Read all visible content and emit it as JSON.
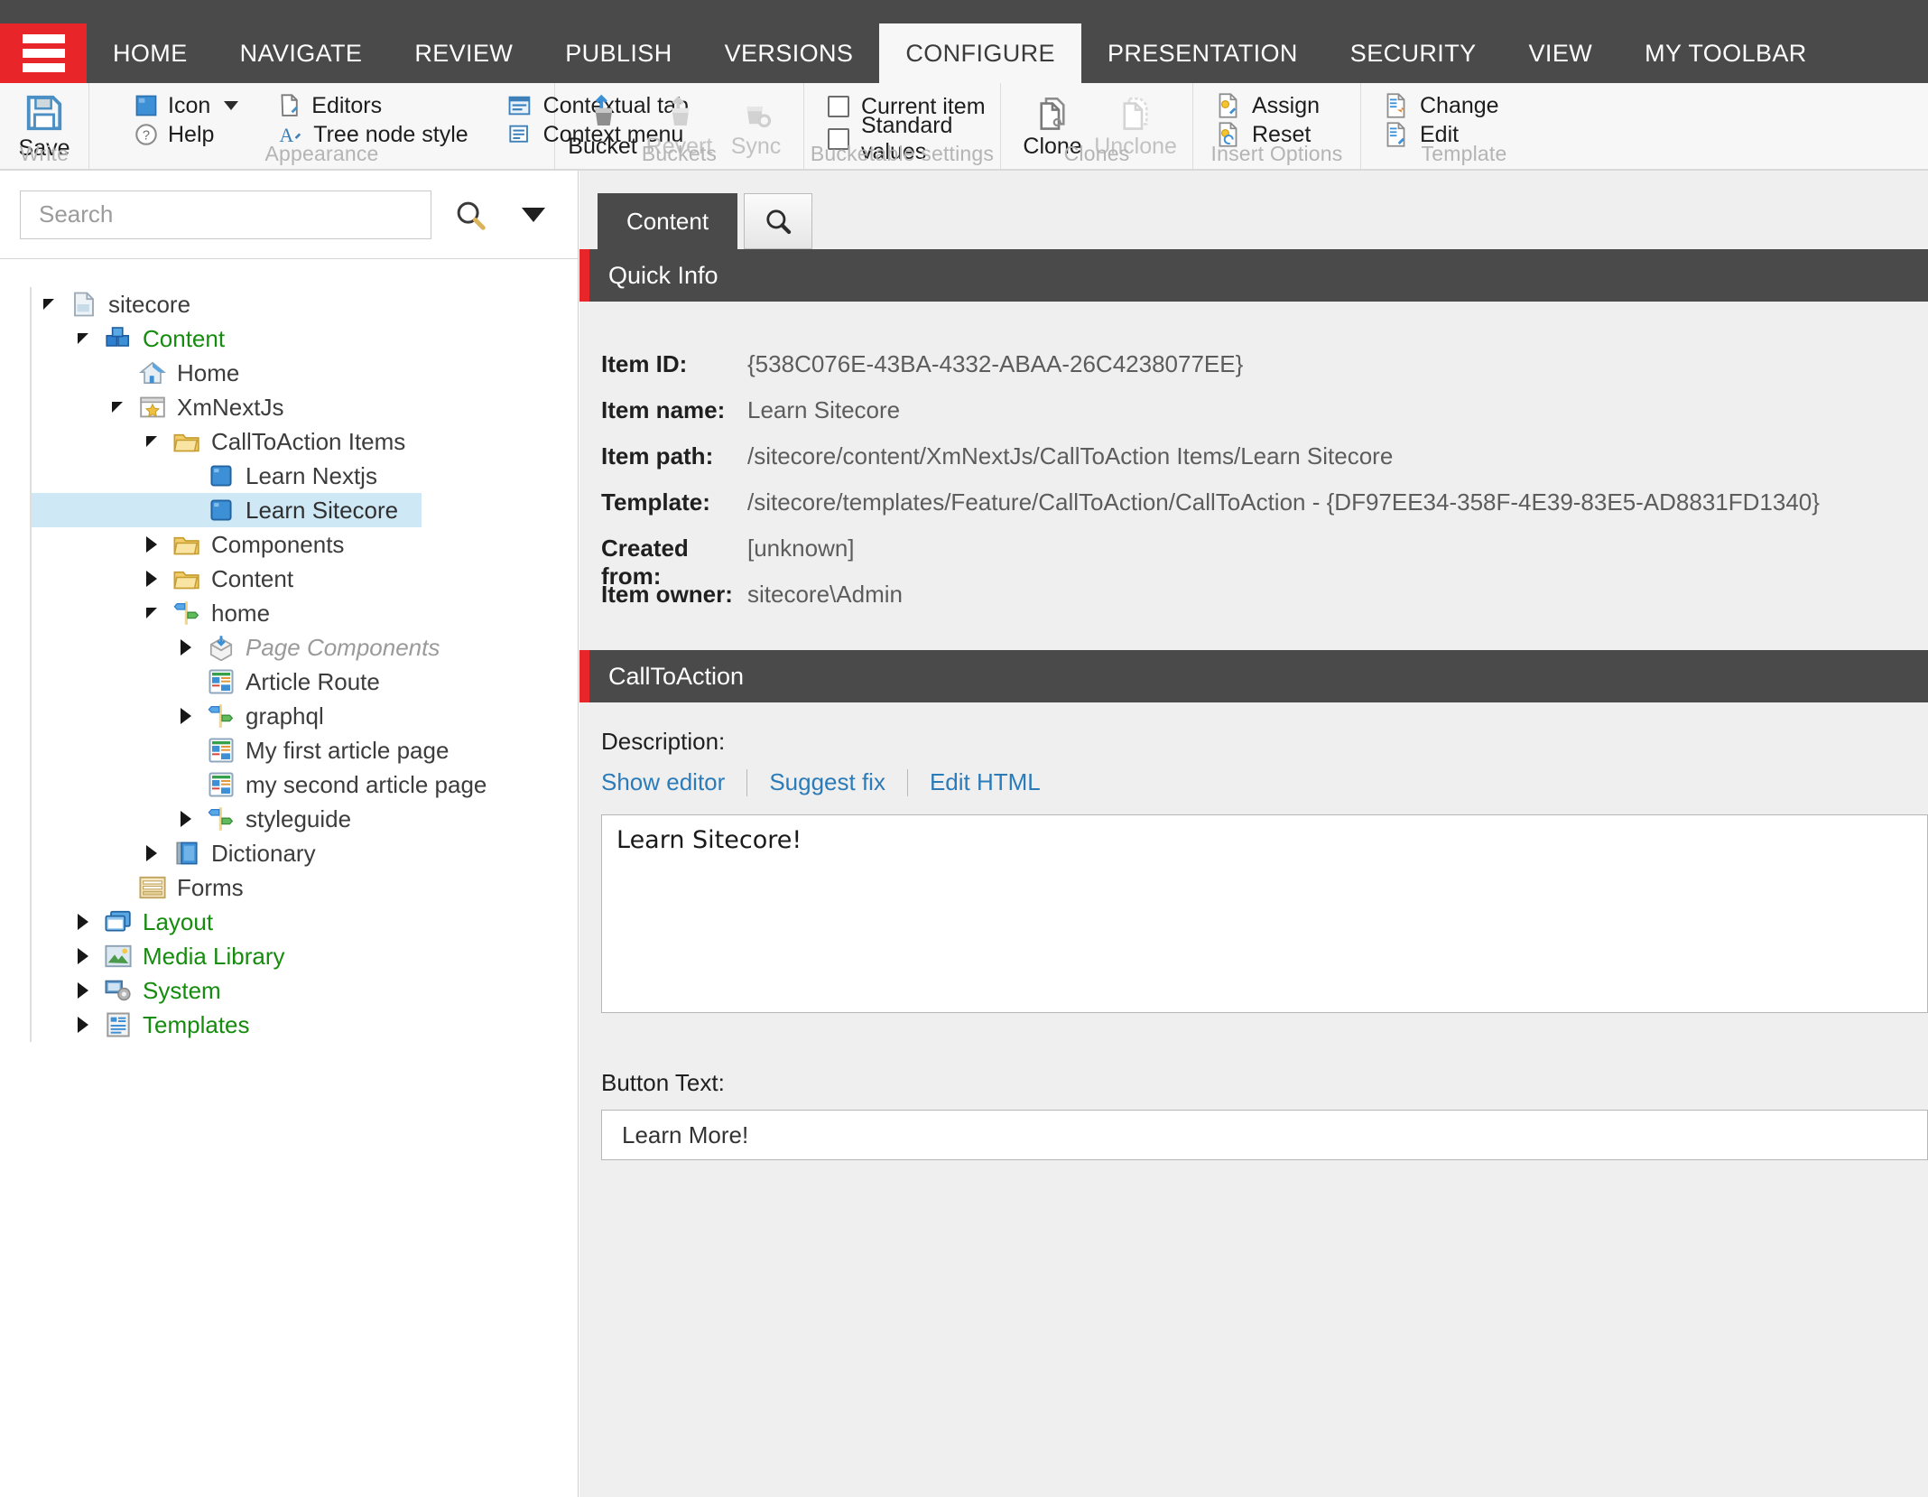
{
  "menubar": {
    "hamburger_label": "menu",
    "tabs": [
      {
        "label": "HOME",
        "active": false
      },
      {
        "label": "NAVIGATE",
        "active": false
      },
      {
        "label": "REVIEW",
        "active": false
      },
      {
        "label": "PUBLISH",
        "active": false
      },
      {
        "label": "VERSIONS",
        "active": false
      },
      {
        "label": "CONFIGURE",
        "active": true
      },
      {
        "label": "PRESENTATION",
        "active": false
      },
      {
        "label": "SECURITY",
        "active": false
      },
      {
        "label": "VIEW",
        "active": false
      },
      {
        "label": "MY TOOLBAR",
        "active": false
      }
    ]
  },
  "ribbon": {
    "groups": {
      "write": {
        "label": "Write",
        "save_label": "Save"
      },
      "appearance": {
        "label": "Appearance",
        "icon_label": "Icon",
        "help_label": "Help",
        "editors_label": "Editors",
        "tree_node_style_label": "Tree node style",
        "contextual_tab_label": "Contextual tab",
        "context_menu_label": "Context menu"
      },
      "buckets": {
        "label": "Buckets",
        "bucket_label": "Bucket",
        "revert_label": "Revert",
        "sync_label": "Sync"
      },
      "bucketable": {
        "label": "Bucketable settings",
        "current_item_label": "Current item",
        "standard_values_label": "Standard values"
      },
      "clones": {
        "label": "Clones",
        "clone_label": "Clone",
        "unclone_label": "Unclone"
      },
      "insert_options": {
        "label": "Insert Options",
        "assign_label": "Assign",
        "reset_label": "Reset"
      },
      "templates": {
        "label": "Template",
        "change_label": "Change",
        "edit_label": "Edit"
      }
    }
  },
  "search": {
    "placeholder": "Search",
    "value": ""
  },
  "tree": {
    "items": [
      {
        "label": "sitecore",
        "indent": 0,
        "twisty": "open",
        "icon": "document-icon",
        "style": "plain",
        "selected": false
      },
      {
        "label": "Content",
        "indent": 1,
        "twisty": "open",
        "icon": "content-icon",
        "style": "green",
        "selected": false
      },
      {
        "label": "Home",
        "indent": 2,
        "twisty": "none",
        "icon": "home-icon",
        "style": "plain",
        "selected": false
      },
      {
        "label": "XmNextJs",
        "indent": 2,
        "twisty": "open",
        "icon": "site-star-icon",
        "style": "plain",
        "selected": false
      },
      {
        "label": "CallToAction Items",
        "indent": 3,
        "twisty": "open",
        "icon": "folder-icon",
        "style": "plain",
        "selected": false
      },
      {
        "label": "Learn Nextjs",
        "indent": 4,
        "twisty": "none",
        "icon": "blue-square-icon",
        "style": "plain",
        "selected": false
      },
      {
        "label": "Learn Sitecore",
        "indent": 4,
        "twisty": "none",
        "icon": "blue-square-icon",
        "style": "plain",
        "selected": true
      },
      {
        "label": "Components",
        "indent": 3,
        "twisty": "closed",
        "icon": "folder-icon",
        "style": "plain",
        "selected": false
      },
      {
        "label": "Content",
        "indent": 3,
        "twisty": "closed",
        "icon": "folder-icon",
        "style": "plain",
        "selected": false
      },
      {
        "label": "home",
        "indent": 3,
        "twisty": "open",
        "icon": "signpost-icon",
        "style": "plain",
        "selected": false
      },
      {
        "label": "Page Components",
        "indent": 4,
        "twisty": "closed",
        "icon": "package-icon",
        "style": "italic",
        "selected": false
      },
      {
        "label": "Article Route",
        "indent": 4,
        "twisty": "none",
        "icon": "page-layout-icon",
        "style": "plain",
        "selected": false
      },
      {
        "label": "graphql",
        "indent": 4,
        "twisty": "closed",
        "icon": "signpost-icon",
        "style": "plain",
        "selected": false
      },
      {
        "label": "My first article page",
        "indent": 4,
        "twisty": "none",
        "icon": "page-layout-icon",
        "style": "plain",
        "selected": false
      },
      {
        "label": "my second article page",
        "indent": 4,
        "twisty": "none",
        "icon": "page-layout-icon",
        "style": "plain",
        "selected": false
      },
      {
        "label": "styleguide",
        "indent": 4,
        "twisty": "closed",
        "icon": "signpost-icon",
        "style": "plain",
        "selected": false
      },
      {
        "label": "Dictionary",
        "indent": 3,
        "twisty": "closed",
        "icon": "book-icon",
        "style": "plain",
        "selected": false
      },
      {
        "label": "Forms",
        "indent": 2,
        "twisty": "none",
        "icon": "forms-icon",
        "style": "plain",
        "selected": false
      },
      {
        "label": "Layout",
        "indent": 1,
        "twisty": "closed",
        "icon": "layout-icon",
        "style": "green",
        "selected": false
      },
      {
        "label": "Media Library",
        "indent": 1,
        "twisty": "closed",
        "icon": "media-icon",
        "style": "green",
        "selected": false
      },
      {
        "label": "System",
        "indent": 1,
        "twisty": "closed",
        "icon": "system-icon",
        "style": "green",
        "selected": false
      },
      {
        "label": "Templates",
        "indent": 1,
        "twisty": "closed",
        "icon": "templates-icon",
        "style": "green",
        "selected": false
      }
    ]
  },
  "content": {
    "tab_label": "Content",
    "quick_info": {
      "header": "Quick Info",
      "rows": [
        {
          "label": "Item ID:",
          "value": "{538C076E-43BA-4332-ABAA-26C4238077EE}"
        },
        {
          "label": "Item name:",
          "value": "Learn Sitecore"
        },
        {
          "label": "Item path:",
          "value": "/sitecore/content/XmNextJs/CallToAction Items/Learn Sitecore"
        },
        {
          "label": "Template:",
          "value": "/sitecore/templates/Feature/CallToAction/CallToAction - {DF97EE34-358F-4E39-83E5-AD8831FD1340}"
        },
        {
          "label": "Created from:",
          "value": "[unknown]"
        },
        {
          "label": "Item owner:",
          "value": "sitecore\\Admin"
        }
      ]
    },
    "section": {
      "header": "CallToAction",
      "description_label": "Description:",
      "links": [
        {
          "label": "Show editor"
        },
        {
          "label": "Suggest fix"
        },
        {
          "label": "Edit HTML"
        }
      ],
      "description_value": "Learn Sitecore!",
      "button_text_label": "Button Text:",
      "button_text_value": "Learn More!"
    }
  },
  "colors": {
    "accent_red": "#e8262a",
    "dark_chrome": "#4a4a4a",
    "link_blue": "#2b7bb9",
    "tree_green": "#168c0e",
    "selection_blue": "#cfe8f6"
  }
}
